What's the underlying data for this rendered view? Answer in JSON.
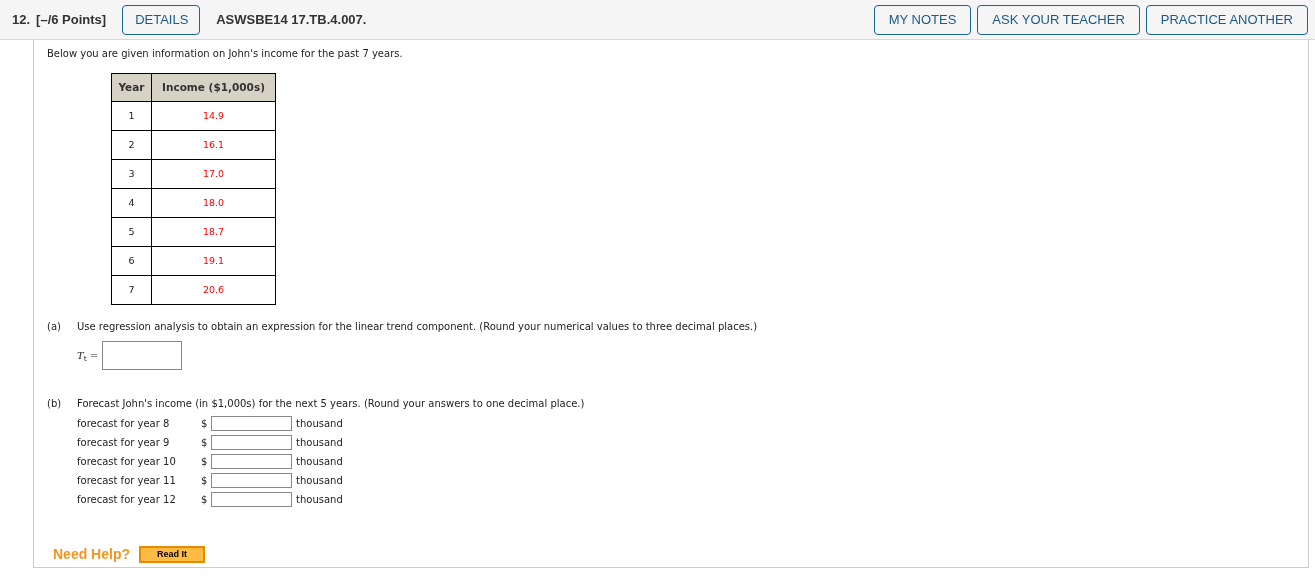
{
  "header": {
    "number": "12.",
    "points": "[–/6 Points]",
    "details_button": "DETAILS",
    "code": "ASWSBE14 17.TB.4.007.",
    "buttons": [
      "MY NOTES",
      "ASK YOUR TEACHER",
      "PRACTICE ANOTHER"
    ]
  },
  "intro": "Below you are given information on John's income for the past 7 years.",
  "table": {
    "columns": [
      "Year",
      "Income ($1,000s)"
    ],
    "rows": [
      {
        "year": "1",
        "income": "14.9"
      },
      {
        "year": "2",
        "income": "16.1"
      },
      {
        "year": "3",
        "income": "17.0"
      },
      {
        "year": "4",
        "income": "18.0"
      },
      {
        "year": "5",
        "income": "18.7"
      },
      {
        "year": "6",
        "income": "19.1"
      },
      {
        "year": "7",
        "income": "20.6"
      }
    ]
  },
  "part_a": {
    "label": "(a)",
    "text": "Use regression analysis to obtain an expression for the linear trend component. (Round your numerical values to three decimal places.)",
    "field_label": "*T*$_{t}$ ="
  },
  "part_b": {
    "label": "(b)",
    "text": "Forecast John's income (in $1,000s) for the next 5 years. (Round your answers to one decimal place.)",
    "rows": [
      {
        "label": "forecast for year 8",
        "prefix": "$",
        "suffix": "thousand"
      },
      {
        "label": "forecast for year 9",
        "prefix": "$",
        "suffix": "thousand"
      },
      {
        "label": "forecast for year 10",
        "prefix": "$",
        "suffix": "thousand"
      },
      {
        "label": "forecast for year 11",
        "prefix": "$",
        "suffix": "thousand"
      },
      {
        "label": "forecast for year 12",
        "prefix": "$",
        "suffix": "thousand"
      }
    ]
  },
  "help": {
    "label": "Need Help?",
    "button": "Read It"
  }
}
